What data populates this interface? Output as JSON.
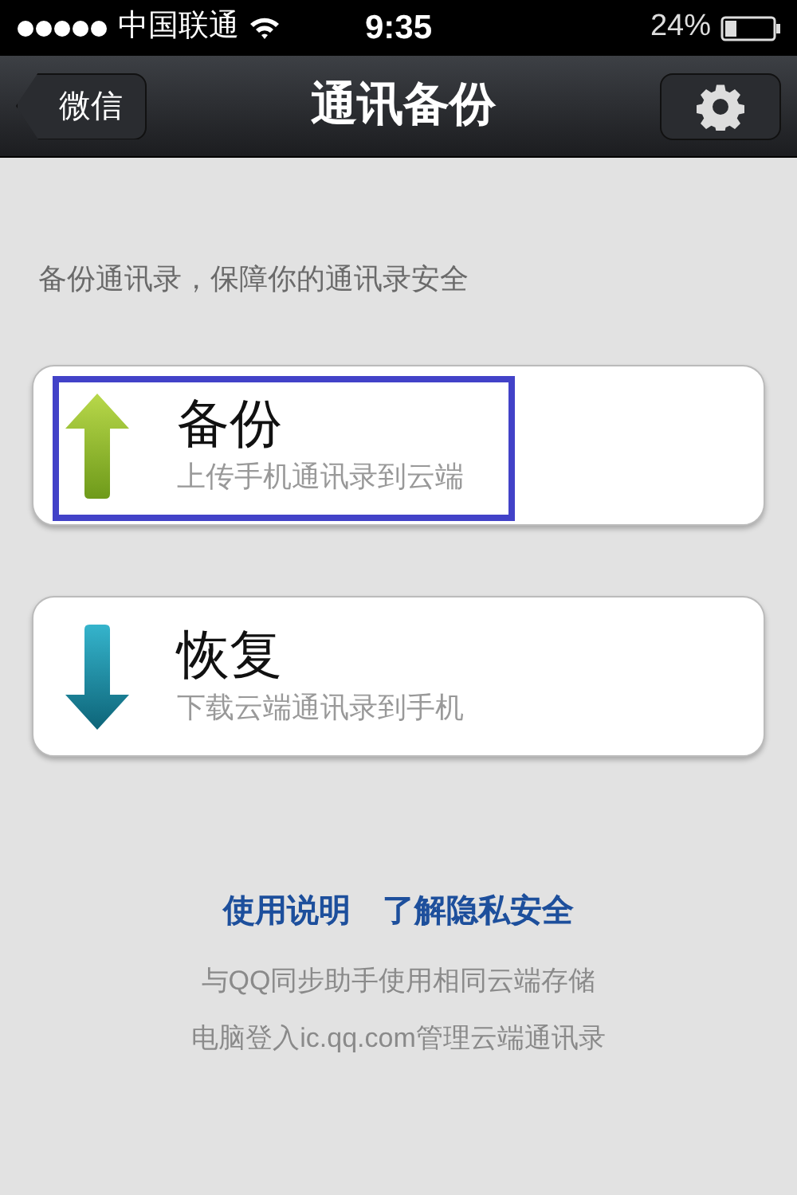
{
  "status_bar": {
    "carrier": "中国联通",
    "time": "9:35",
    "battery": "24%"
  },
  "nav_bar": {
    "back": "微信",
    "title": "通讯备份"
  },
  "description": "备份通讯录，保障你的通讯录安全",
  "actions": [
    {
      "kind": "upload",
      "title": "备份",
      "subtitle": "上传手机通讯录到云端",
      "highlighted": true
    },
    {
      "kind": "download",
      "title": "恢复",
      "subtitle": "下载云端通讯录到手机",
      "highlighted": false
    }
  ],
  "links": [
    "使用说明",
    "了解隐私安全"
  ],
  "notes": [
    "与QQ同步助手使用相同云端存储",
    "电脑登入ic.qq.com管理云端通讯录"
  ]
}
